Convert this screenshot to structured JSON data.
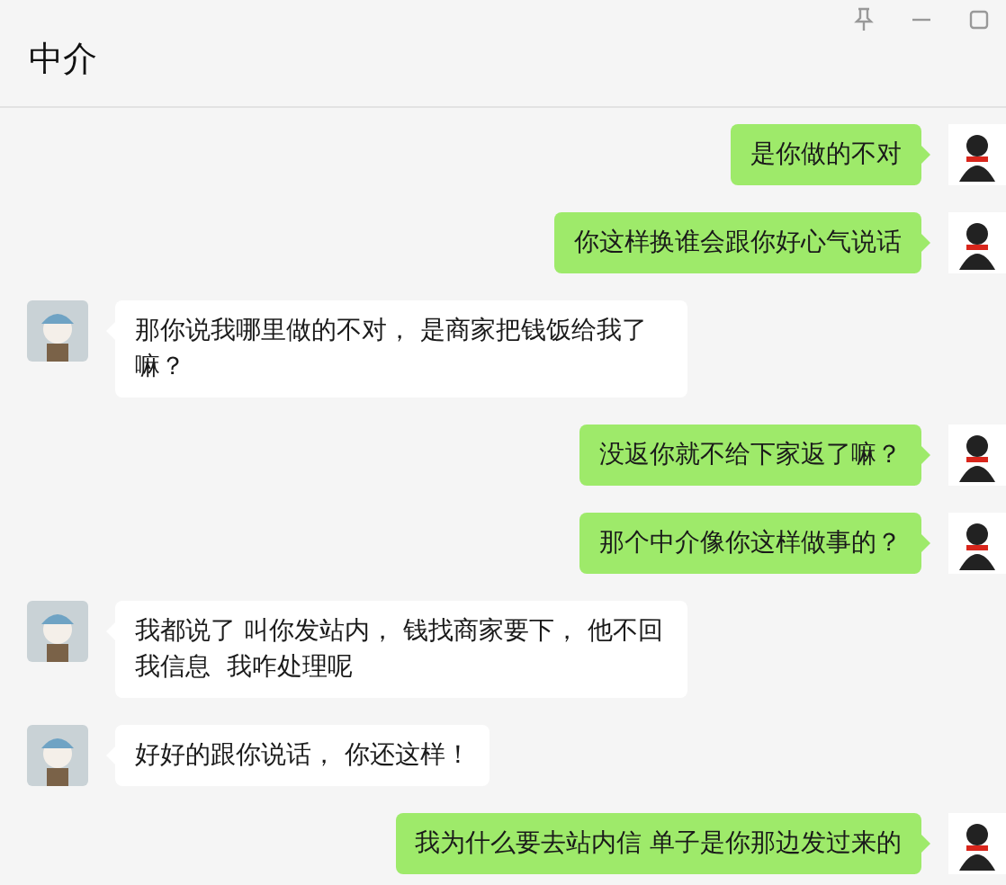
{
  "window": {
    "title": "中介"
  },
  "messages": [
    {
      "kind": "sent",
      "text": "是你做的不对"
    },
    {
      "kind": "sent",
      "text": "你这样换谁会跟你好心气说话"
    },
    {
      "kind": "received",
      "text": "那你说我哪里做的不对， 是商家把钱饭给我了嘛？"
    },
    {
      "kind": "sent",
      "text": "没返你就不给下家返了嘛？"
    },
    {
      "kind": "sent",
      "text": "那个中介像你这样做事的？"
    },
    {
      "kind": "received",
      "text": "我都说了 叫你发站内， 钱找商家要下， 他不回我信息  我咋处理呢"
    },
    {
      "kind": "received",
      "text": "好好的跟你说话， 你还这样！"
    },
    {
      "kind": "sent",
      "text": "我为什么要去站内信 单子是你那边发过来的"
    }
  ]
}
